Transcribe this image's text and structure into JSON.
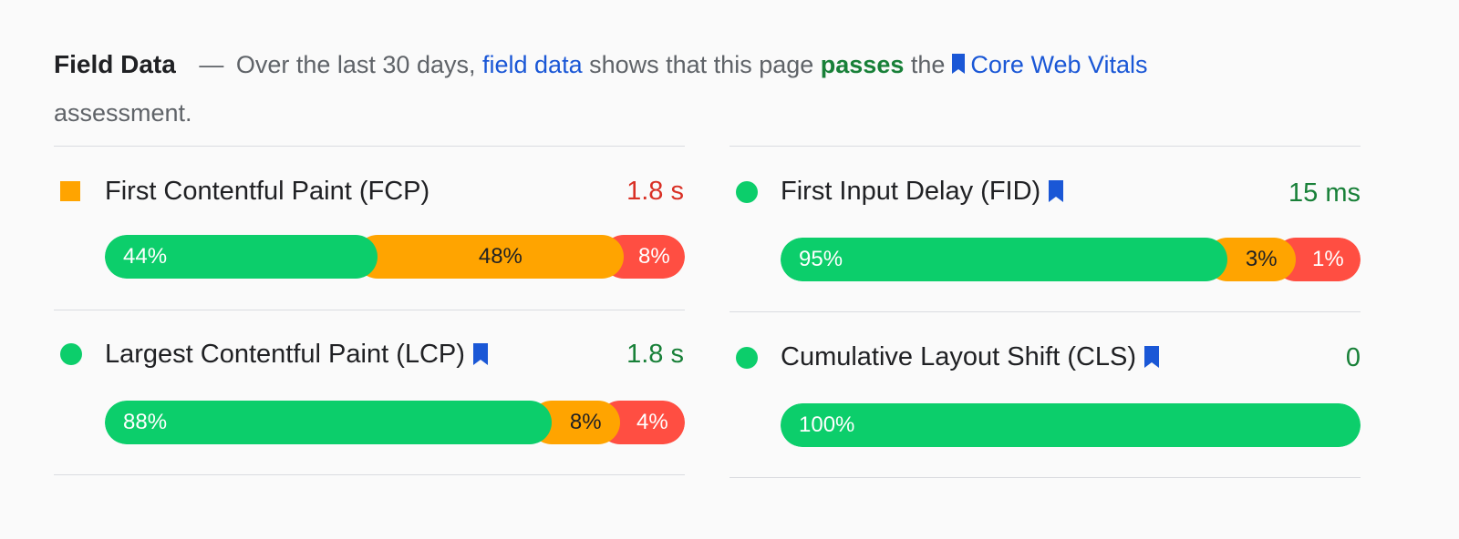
{
  "header": {
    "title": "Field Data",
    "dash": "—",
    "text1": "Over the last 30 days,",
    "link1": "field data",
    "text2": "shows that this page",
    "status": "passes",
    "text3": "the",
    "link2": "Core Web Vitals",
    "text4": "assessment."
  },
  "colors": {
    "good": "#0cce6b",
    "needs_improvement": "#ffa400",
    "poor": "#ff4e42",
    "link": "#1a57d6",
    "pass_text": "#188038"
  },
  "metrics": {
    "fcp": {
      "name": "First Contentful Paint (FCP)",
      "value": "1.8 s",
      "status": "needs-improvement",
      "core_vital": false,
      "distribution": {
        "good": "44%",
        "needs_improvement": "48%",
        "poor": "8%"
      }
    },
    "fid": {
      "name": "First Input Delay (FID)",
      "value": "15 ms",
      "status": "good",
      "core_vital": true,
      "distribution": {
        "good": "95%",
        "needs_improvement": "3%",
        "poor": "1%"
      }
    },
    "lcp": {
      "name": "Largest Contentful Paint (LCP)",
      "value": "1.8 s",
      "status": "good",
      "core_vital": true,
      "distribution": {
        "good": "88%",
        "needs_improvement": "8%",
        "poor": "4%"
      }
    },
    "cls": {
      "name": "Cumulative Layout Shift (CLS)",
      "value": "0",
      "status": "good",
      "core_vital": true,
      "distribution": {
        "good": "100%"
      }
    }
  }
}
